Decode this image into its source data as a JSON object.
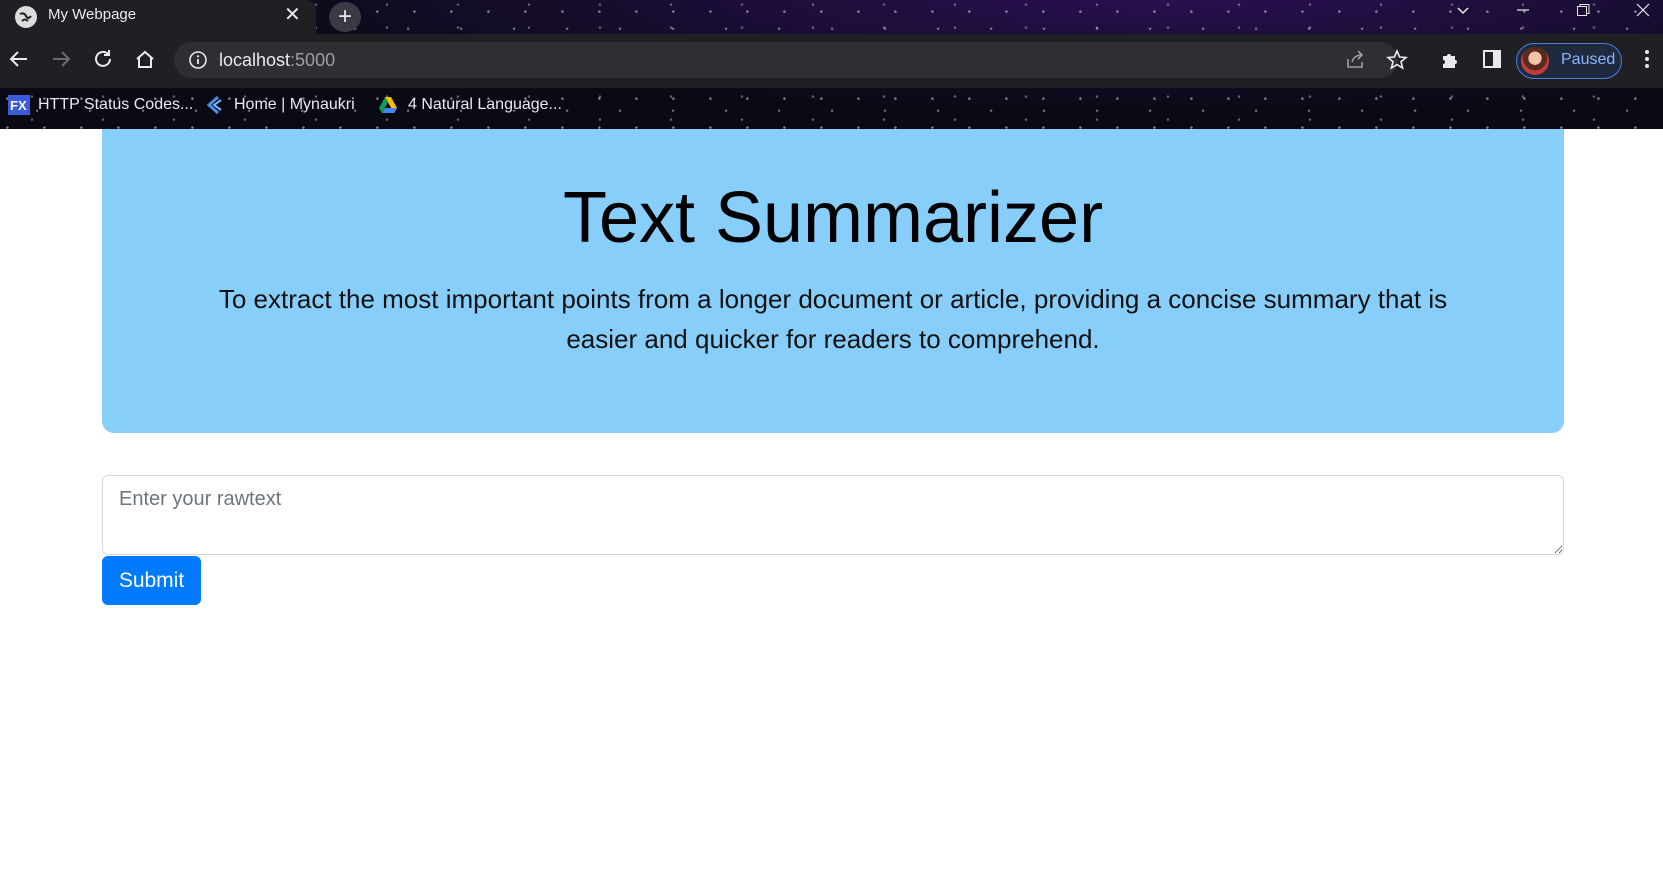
{
  "browser": {
    "tab_title": "My Webpage",
    "url_host": "localhost",
    "url_port": ":5000",
    "profile_label": "Paused",
    "bookmarks": [
      {
        "label": "HTTP Status Codes...",
        "icon": "fx-icon"
      },
      {
        "label": "Home | Mynaukri",
        "icon": "naukri-icon"
      },
      {
        "label": "4 Natural Language...",
        "icon": "google-drive-icon"
      }
    ]
  },
  "hero": {
    "title": "Text Summarizer",
    "description": "To extract the most important points from a longer document or article, providing a concise summary that is easier and quicker for readers to comprehend.",
    "background_color": "#87cefa"
  },
  "form": {
    "input_placeholder": "Enter your rawtext",
    "input_value": "",
    "submit_label": "Submit",
    "submit_color": "#007bff"
  }
}
